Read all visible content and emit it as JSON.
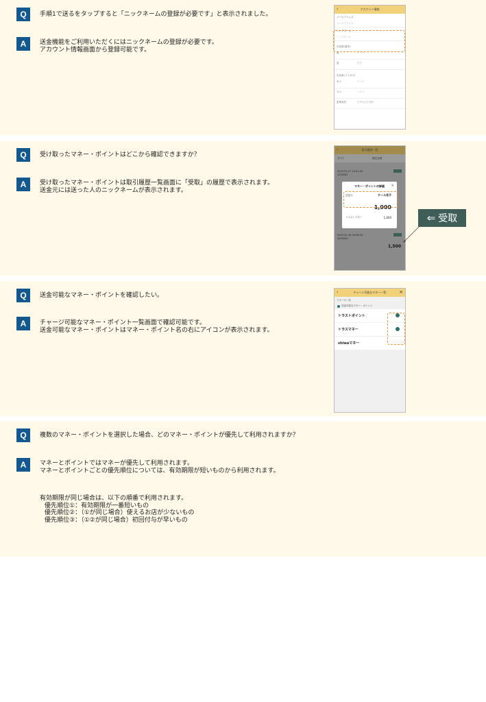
{
  "faq": [
    {
      "q_label": "Q",
      "a_label": "A",
      "question": "手順1で送るをタップすると「ニックネームの登録が必要です」と表示されました。",
      "answer_lines": [
        "送金機能をご利用いただくにはニックネームの登録が必要です。",
        "アカウント情報画面から登録可能です。"
      ]
    },
    {
      "q_label": "Q",
      "a_label": "A",
      "question": "受け取ったマネー・ポイントはどこから確認できますか？",
      "answer_lines": [
        "受け取ったマネー・ポイントは取引履歴一覧画面に「受取」の履歴で表示されます。",
        "送金元には送った人のニックネームが表示されます。"
      ]
    },
    {
      "q_label": "Q",
      "a_label": "A",
      "question": "送金可能なマネー・ポイントを確認したい。",
      "answer_lines": [
        "チャージ可能なマネー・ポイント一覧画面で確認可能です。",
        "送金可能なマネー・ポイントはマネー・ポイント名の右にアイコンが表示されます。"
      ]
    },
    {
      "q_label": "Q",
      "a_label": "A",
      "question": "複数のマネー・ポイントを選択した場合、どのマネー・ポイントが優先して利用されますか？",
      "answer_lines": [
        "マネーとポイントではマネーが優先して利用されます。",
        "マネーとポイントごとの優先順位については、有効期限が短いものから利用されます。"
      ],
      "extra_lines": [
        "有効期限が同じ場合は、以下の順番で利用されます。",
        "優先順位①：有効期限が一番短いもの",
        "優先順位②：（①が同じ場合）使えるお店が少ないもの",
        "優先順位③：（①②が同じ場合）初回付与が早いもの"
      ]
    }
  ],
  "phone1": {
    "title": "アカウント情報",
    "rows": [
      {
        "label": "メールアドレス",
        "value": "メールアドレス"
      },
      {
        "label": "ニックネーム",
        "value": "ニックネーム"
      },
      {
        "label": "お名前(漢字)",
        "value": ""
      },
      {
        "label": "姓",
        "value": "テール"
      },
      {
        "label": "名",
        "value": "花子"
      },
      {
        "label": "お名前(フリガナ)",
        "value": ""
      },
      {
        "label": "セイ",
        "value": "テール"
      },
      {
        "label": "メイ",
        "value": "ハナコ"
      },
      {
        "label": "生年月日",
        "value": "生年月日を選択"
      }
    ]
  },
  "phone2": {
    "title": "取引履歴一覧",
    "filter1": "すべて",
    "filter2": "発生日順",
    "entry1_date": "2023-03-27 12:01:40",
    "entry1_id": "1234567",
    "modal_title": "マネー・ポイントの詳細",
    "modal_from_label": "送金元",
    "modal_from_value": "テール花子",
    "modal_amount": "1,000",
    "modal_sub_label": "トラストマネー",
    "modal_sub_value": "1,000",
    "entry2_date": "2024-01-26 09:06:34",
    "entry2_id": "0000000",
    "entry2_amount": "1,500",
    "callout": "受取"
  },
  "phone3": {
    "title": "チャージ可能なマネー一覧",
    "subtitle": "マネーの一覧",
    "legend": "送金可能なマネー・ポイント",
    "items": [
      "トラストポイント",
      "トラスマネー",
      "shiwaマネー"
    ]
  }
}
